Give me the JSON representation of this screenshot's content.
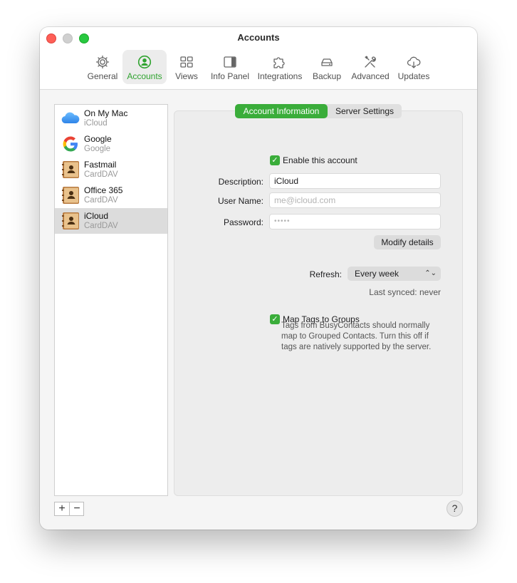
{
  "window": {
    "title": "Accounts"
  },
  "toolbar": {
    "items": [
      {
        "label": "General",
        "icon": "gear-icon"
      },
      {
        "label": "Accounts",
        "icon": "person-circle-icon",
        "active": true
      },
      {
        "label": "Views",
        "icon": "grid-icon"
      },
      {
        "label": "Info Panel",
        "icon": "sidebar-panel-icon"
      },
      {
        "label": "Integrations",
        "icon": "puzzle-icon"
      },
      {
        "label": "Backup",
        "icon": "drive-icon"
      },
      {
        "label": "Advanced",
        "icon": "tools-icon"
      },
      {
        "label": "Updates",
        "icon": "cloud-download-icon"
      }
    ]
  },
  "sidebar": {
    "accounts": [
      {
        "name": "On My Mac",
        "type": "iCloud",
        "icon": "icloud-icon"
      },
      {
        "name": "Google",
        "type": "Google",
        "icon": "google-icon"
      },
      {
        "name": "Fastmail",
        "type": "CardDAV",
        "icon": "address-book-icon"
      },
      {
        "name": "Office 365",
        "type": "CardDAV",
        "icon": "address-book-icon"
      },
      {
        "name": "iCloud",
        "type": "CardDAV",
        "icon": "address-book-icon",
        "selected": true
      }
    ],
    "add_label": "+",
    "remove_label": "−"
  },
  "tabs": {
    "account_info": "Account Information",
    "server_settings": "Server Settings"
  },
  "form": {
    "enable_label": "Enable this account",
    "description_label": "Description:",
    "description_value": "iCloud",
    "username_label": "User Name:",
    "username_placeholder": "me@icloud.com",
    "password_label": "Password:",
    "password_value": "•••••",
    "modify_label": "Modify details",
    "refresh_label": "Refresh:",
    "refresh_value": "Every week",
    "last_synced": "Last synced: never",
    "map_tags_label": "Map Tags to Groups",
    "map_tags_note": "Tags from BusyContacts should normally map to Grouped Contacts. Turn this off if tags are natively supported by the server."
  },
  "help_label": "?",
  "colors": {
    "accent": "#3aad3a",
    "close": "#fe5f57",
    "maximize": "#28c840"
  }
}
